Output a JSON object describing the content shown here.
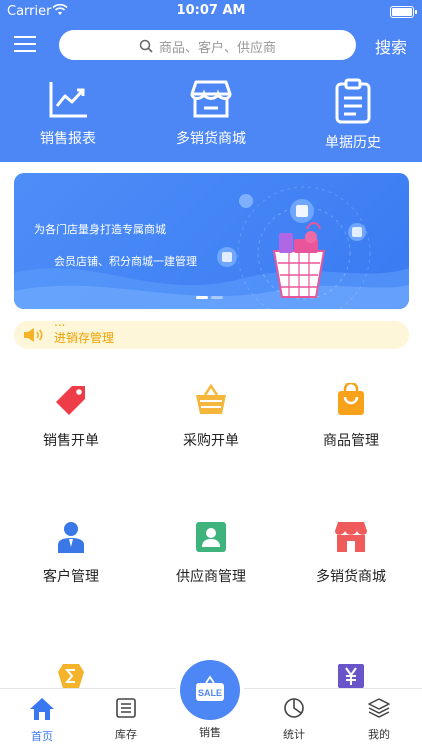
{
  "status_bar": {
    "carrier": "Carrier",
    "time": "10:07 AM"
  },
  "header": {
    "search_placeholder": "商品、客户、供应商",
    "search_button": "搜索",
    "shortcuts": [
      {
        "label": "销售报表",
        "icon": "line-chart-icon"
      },
      {
        "label": "多销货商城",
        "icon": "store-icon"
      },
      {
        "label": "单据历史",
        "icon": "clipboard-icon"
      }
    ]
  },
  "banner": {
    "line1": "为各门店量身打造专属商城",
    "line2": "会员店铺、积分商城一建管理",
    "page_count": 2,
    "active_page": 1
  },
  "notice": {
    "text": "进销存管理",
    "previous_text": "...",
    "icon": "speaker-icon",
    "color": "#f0a200"
  },
  "functions": [
    {
      "label": "销售开单",
      "icon": "tag-icon",
      "color": "#ee3d48"
    },
    {
      "label": "采购开单",
      "icon": "basket-icon",
      "color": "#f5b73b"
    },
    {
      "label": "商品管理",
      "icon": "shopping-bag-icon",
      "color": "#f8a21c"
    },
    {
      "label": "客户管理",
      "icon": "customer-icon",
      "color": "#3a78e8"
    },
    {
      "label": "供应商管理",
      "icon": "supplier-icon",
      "color": "#3fb37c"
    },
    {
      "label": "多销货商城",
      "icon": "shop-icon",
      "color": "#ef5a5a"
    },
    {
      "label": "",
      "icon": "sigma-icon",
      "color": "#f5b32a"
    },
    {
      "label": "",
      "icon": "yuan-icon",
      "color": "#6a54c9"
    }
  ],
  "tabbar": {
    "tabs": [
      {
        "label": "首页",
        "icon": "home-icon",
        "active": true
      },
      {
        "label": "库存",
        "icon": "inventory-icon",
        "active": false
      },
      {
        "label": "销售",
        "icon": "sale-icon",
        "active": false
      },
      {
        "label": "统计",
        "icon": "pie-chart-icon",
        "active": false
      },
      {
        "label": "我的",
        "icon": "layers-icon",
        "active": false
      }
    ],
    "sale_badge": "SALE"
  },
  "colors": {
    "primary": "#4d86f5",
    "active_tab": "#3a78f2",
    "notice_bg": "#fdf6d9"
  }
}
